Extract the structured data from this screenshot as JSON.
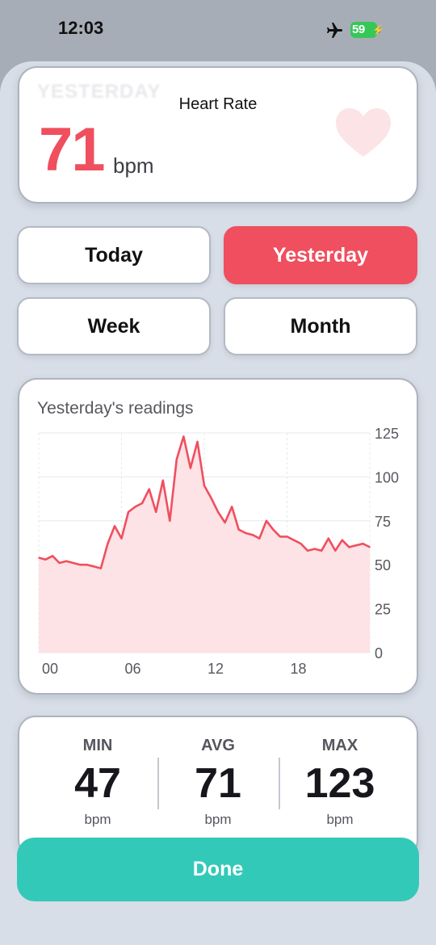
{
  "status_bar": {
    "time": "12:03",
    "battery": "59",
    "airplane_icon": "airplane-icon",
    "battery_icon": "battery-charging-icon"
  },
  "hero": {
    "ghost_label": "YESTERDAY",
    "title": "Heart Rate",
    "value": "71",
    "unit": "bpm",
    "icon": "heart-icon",
    "accent": "#ef4f5e"
  },
  "segments": [
    {
      "label": "Today",
      "active": false
    },
    {
      "label": "Yesterday",
      "active": true
    },
    {
      "label": "Week",
      "active": false
    },
    {
      "label": "Month",
      "active": false
    }
  ],
  "chart": {
    "title": "Yesterday's readings"
  },
  "chart_data": {
    "type": "area",
    "title": "Yesterday's readings",
    "xlabel": "",
    "ylabel": "",
    "xlim": [
      0,
      24
    ],
    "ylim": [
      0,
      125
    ],
    "x_ticks": [
      "00",
      "06",
      "12",
      "18"
    ],
    "y_ticks": [
      "125",
      "100",
      "75",
      "50",
      "25",
      "0"
    ],
    "grid": true,
    "line_color": "#ef4f5e",
    "fill_color": "#fde2e6",
    "series": [
      {
        "x": [
          0,
          0.5,
          1,
          1.5,
          2,
          2.5,
          3,
          3.5,
          4,
          4.5,
          5,
          5.5,
          6,
          6.5,
          7,
          7.5,
          8,
          8.5,
          9,
          9.5,
          10,
          10.5,
          11,
          11.5,
          12,
          12.5,
          13,
          13.5,
          14,
          14.5,
          15,
          15.5,
          16,
          16.5,
          17,
          17.5,
          18,
          18.5,
          19,
          19.5,
          20,
          20.5,
          21,
          21.5,
          22,
          22.5,
          23,
          23.5,
          24
        ],
        "y": [
          54,
          53,
          55,
          51,
          52,
          51,
          50,
          50,
          49,
          48,
          62,
          72,
          65,
          80,
          83,
          85,
          93,
          80,
          98,
          75,
          110,
          123,
          105,
          120,
          95,
          88,
          80,
          74,
          83,
          70,
          68,
          67,
          65,
          75,
          70,
          66,
          66,
          64,
          62,
          58,
          59,
          58,
          65,
          58,
          64,
          60,
          61,
          62,
          60
        ]
      }
    ]
  },
  "stats": {
    "min": {
      "label": "MIN",
      "value": "47",
      "unit": "bpm"
    },
    "avg": {
      "label": "AVG",
      "value": "71",
      "unit": "bpm"
    },
    "max": {
      "label": "MAX",
      "value": "123",
      "unit": "bpm"
    }
  },
  "done_label": "Done",
  "colors": {
    "accent": "#ef4f5e",
    "done": "#33c9b8",
    "sheet_bg": "#d8dee7"
  }
}
